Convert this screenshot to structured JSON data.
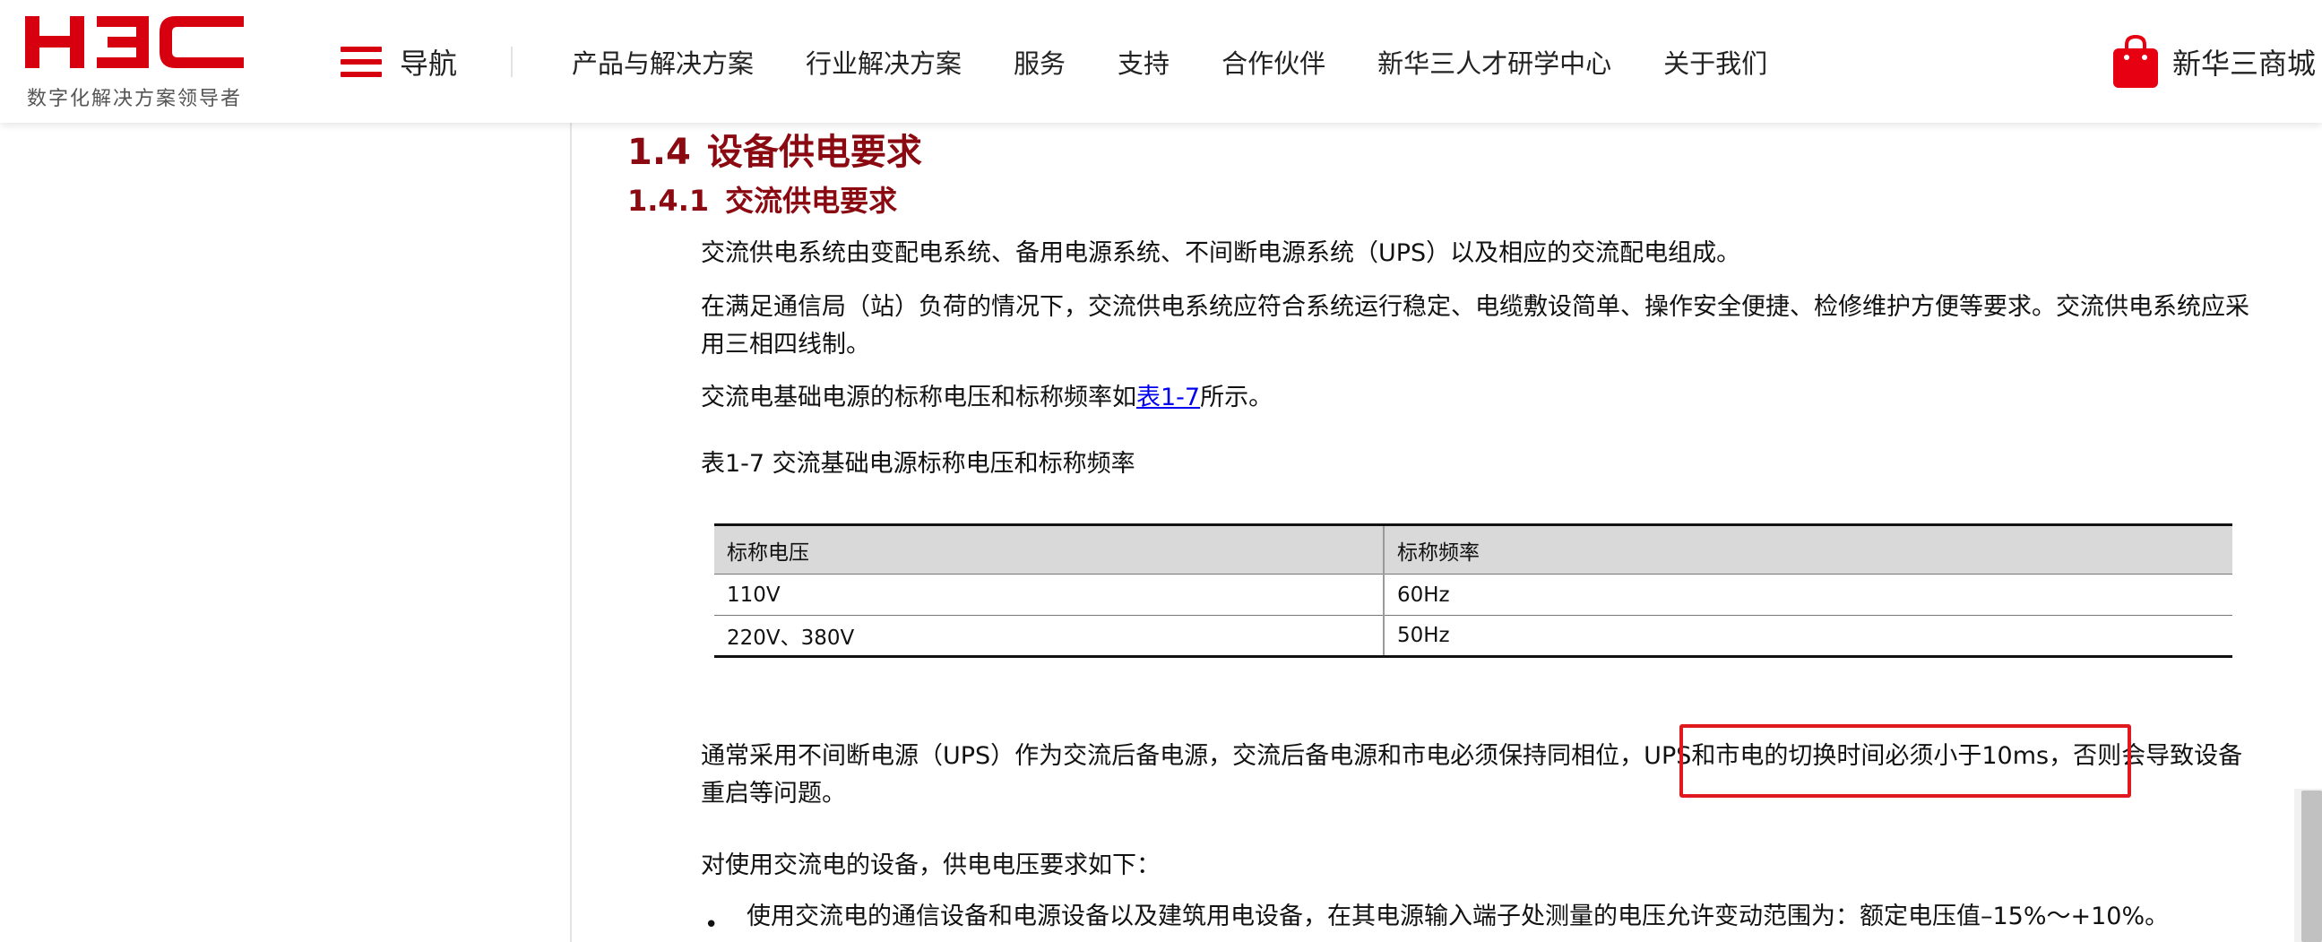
{
  "header": {
    "logo_text": "H3C",
    "tagline": "数字化解决方案领导者",
    "nav_toggle_label": "导航",
    "nav_items": [
      "产品与解决方案",
      "行业解决方案",
      "服务",
      "支持",
      "合作伙伴",
      "新华三人才研学中心",
      "关于我们"
    ],
    "shop_label": "新华三商城",
    "brand_color": "#d7000f"
  },
  "doc": {
    "section_number": "1.4",
    "section_title": "设备供电要求",
    "subsection_number": "1.4.1",
    "subsection_title": "交流供电要求",
    "p1": "交流供电系统由变配电系统、备用电源系统、不间断电源系统（UPS）以及相应的交流配电组成。",
    "p2_line1": "在满足通信局（站）负荷的情况下，交流供电系统应符合系统运行稳定、电缆敷设简单、操作安全便捷、检修维护方便等要求。交流供电系统应采",
    "p2_line2": "用三相四线制。",
    "p3_before": "交流电基础电源的标称电压和标称频率如",
    "p3_link": "表1-7",
    "p3_after": "所示。",
    "table_caption": "表1-7 交流基础电源标称电压和标称频率",
    "table": {
      "headers": [
        "标称电压",
        "标称频率"
      ],
      "rows": [
        [
          "110V",
          "60Hz"
        ],
        [
          "220V、380V",
          "50Hz"
        ]
      ]
    },
    "p4_line1": "通常采用不间断电源（UPS）作为交流后备电源，交流后备电源和市电必须保持同相位，UPS和市电的切换时间必须小于10ms，否则会导致设备",
    "p4_line2": "重启等问题。",
    "p5": "对使用交流电的设备，供电电压要求如下：",
    "bullet1": "使用交流电的通信设备和电源设备以及建筑用电设备，在其电源输入端子处测量的电压允许变动范围为：额定电压值–15%～+10%。",
    "heading_color": "#8b0a12",
    "highlight_color": "#e0191e"
  }
}
